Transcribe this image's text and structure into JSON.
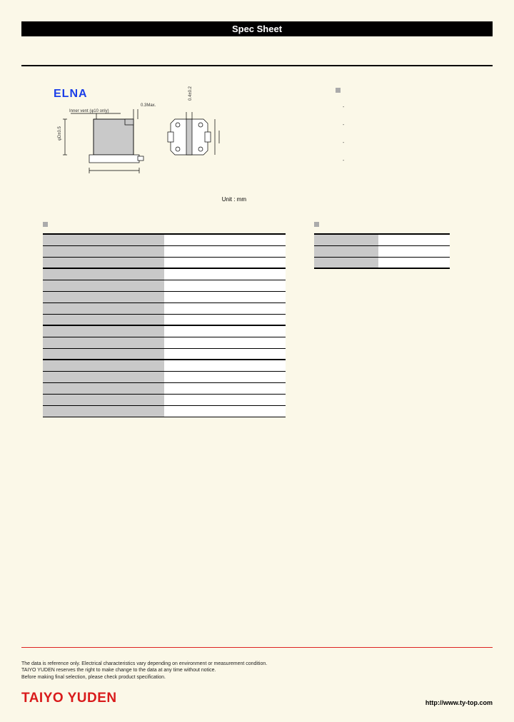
{
  "header": {
    "title": "Spec Sheet"
  },
  "brand": {
    "elna": "ELNA",
    "taiyo": "TAIYO YUDEN"
  },
  "drawing": {
    "vent_label": "Inner vent (φ10 only)",
    "dim1": "0.3Max.",
    "dim2": "0.4±0.2",
    "unit": "Unit : mm"
  },
  "bullets": {
    "items": [
      "",
      "",
      "",
      ""
    ]
  },
  "spec_table": {
    "rows": [
      {
        "label": "",
        "value": ""
      },
      {
        "label": "",
        "value": ""
      },
      {
        "label": "",
        "value": ""
      },
      {
        "label": "",
        "value": ""
      },
      {
        "label": "",
        "value": ""
      },
      {
        "label": "",
        "value": ""
      },
      {
        "label": "",
        "value": ""
      },
      {
        "label": "",
        "value": ""
      },
      {
        "label": "",
        "value": ""
      },
      {
        "label": "",
        "value": ""
      },
      {
        "label": "",
        "value": ""
      },
      {
        "label": "",
        "value": ""
      },
      {
        "label": "",
        "value": ""
      },
      {
        "label": "",
        "value": ""
      },
      {
        "label": "",
        "value": ""
      },
      {
        "label": "",
        "value": ""
      }
    ]
  },
  "small_table": {
    "rows": [
      {
        "label": "",
        "value": ""
      },
      {
        "label": "",
        "value": ""
      },
      {
        "label": "",
        "value": ""
      }
    ]
  },
  "footer": {
    "note1": "The data is reference only. Electrical characteristics vary depending on environment or measurement condition.",
    "note2": "TAIYO YUDEN reserves the right to make change to the data at any time without notice.",
    "note3": "Before making final selection, please check product specification.",
    "url": "http://www.ty-top.com"
  }
}
